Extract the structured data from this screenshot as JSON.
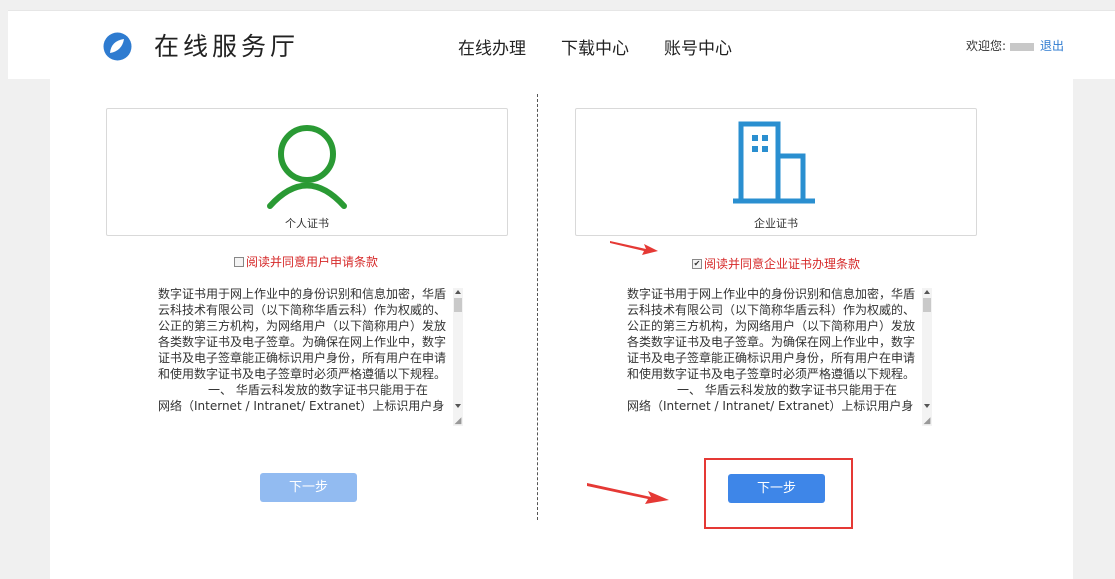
{
  "header": {
    "logo_text": "在线服务厅",
    "nav": [
      "在线办理",
      "下载中心",
      "账号中心"
    ],
    "welcome": "欢迎您:",
    "logout": "退出"
  },
  "personal": {
    "label": "个人证书",
    "agree": "阅读并同意用户申请条款",
    "agree_checked": false,
    "terms": "数字证书用于网上作业中的身份识别和信息加密，华盾云科技术有限公司（以下简称华盾云科）作为权威的、公正的第三方机构，为网络用户（以下简称用户）发放各类数字证书及电子签章。为确保在网上作业中，数字证书及电子签章能正确标识用户身份，所有用户在申请和使用数字证书及电子签章时必须严格遵循以下规程。",
    "terms_clause": "一、 华盾云科发放的数字证书只能用于在",
    "terms_cut": "网络（Internet / Intranet/ Extranet）上标识用户身",
    "next": "下一步",
    "icon_color": "#2a9a34"
  },
  "enterprise": {
    "label": "企业证书",
    "agree": "阅读并同意企业证书办理条款",
    "agree_checked": true,
    "terms": "数字证书用于网上作业中的身份识别和信息加密，华盾云科技术有限公司（以下简称华盾云科）作为权威的、公正的第三方机构，为网络用户（以下简称用户）发放各类数字证书及电子签章。为确保在网上作业中，数字证书及电子签章能正确标识用户身份，所有用户在申请和使用数字证书及电子签章时必须严格遵循以下规程。",
    "terms_clause": "一、 华盾云科发放的数字证书只能用于在",
    "terms_cut": "网络（Internet / Intranet/ Extranet）上标识用户身",
    "next": "下一步",
    "icon_color": "#2a8fd0"
  },
  "colors": {
    "accent": "#3e86e8",
    "disabled": "#92bbf1",
    "annotation": "#e53935",
    "agree_text": "#d62a2a"
  },
  "icons": [
    "logo-icon",
    "person-icon",
    "building-icon",
    "arrow-annotation"
  ]
}
